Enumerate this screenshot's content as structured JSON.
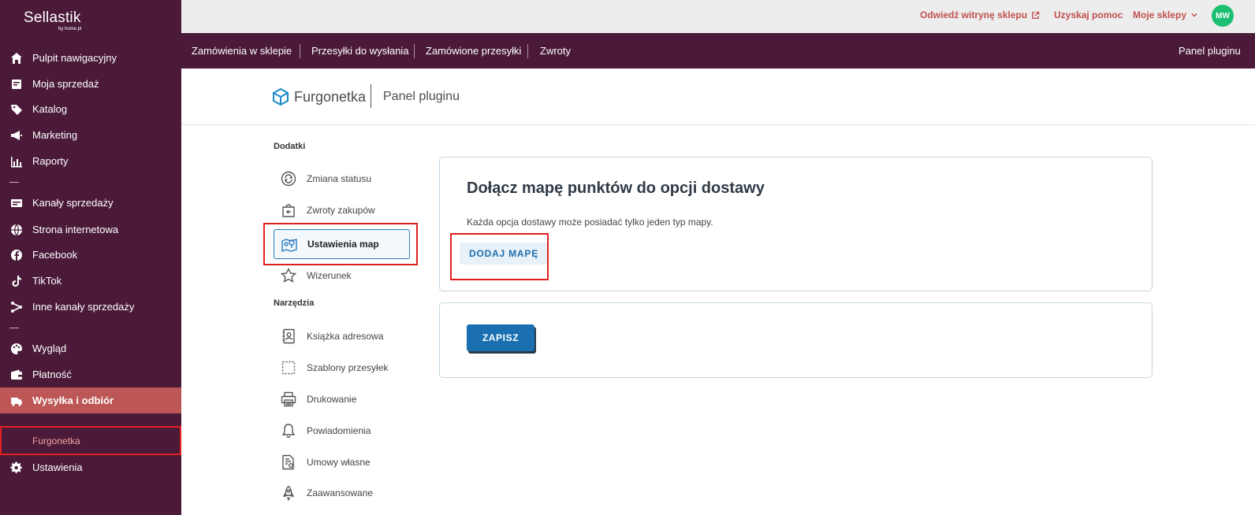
{
  "brand": {
    "name": "Sellastik",
    "sub": "by home.pl"
  },
  "sidebar": {
    "items": [
      {
        "label": "Pulpit nawigacyjny",
        "icon": "home-icon"
      },
      {
        "label": "Moja sprzedaż",
        "icon": "sales-icon"
      },
      {
        "label": "Katalog",
        "icon": "tag-icon"
      },
      {
        "label": "Marketing",
        "icon": "megaphone-icon"
      },
      {
        "label": "Raporty",
        "icon": "bar-chart-icon"
      },
      {
        "label": "Kanały sprzedaży",
        "icon": "channels-icon"
      },
      {
        "label": "Strona internetowa",
        "icon": "globe-icon"
      },
      {
        "label": "Facebook",
        "icon": "facebook-icon"
      },
      {
        "label": "TikTok",
        "icon": "tiktok-icon"
      },
      {
        "label": "Inne kanały sprzedaży",
        "icon": "share-icon"
      },
      {
        "label": "Wygląd",
        "icon": "palette-icon"
      },
      {
        "label": "Płatność",
        "icon": "wallet-icon"
      },
      {
        "label": "Wysyłka i odbiór",
        "icon": "truck-icon",
        "active": true
      },
      {
        "label": "Ustawienia",
        "icon": "gear-icon"
      }
    ],
    "subitem": "Furgonetka"
  },
  "topbar": {
    "visit_store": "Odwiedź witrynę sklepu",
    "help": "Uzyskaj pomoc",
    "my_stores": "Moje sklepy",
    "avatar": "MW"
  },
  "plugin_nav": {
    "tabs": [
      "Zamówienia w sklepie",
      "Przesyłki do wysłania",
      "Zamówione przesyłki",
      "Zwroty"
    ],
    "right": "Panel pluginu"
  },
  "header": {
    "logo_name": "Furgonetka",
    "title": "Panel pluginu"
  },
  "menu": {
    "section1_title": "Dodatki",
    "section1_items": [
      {
        "label": "Zmiana statusu",
        "icon": "refresh-icon"
      },
      {
        "label": "Zwroty zakupów",
        "icon": "return-bag-icon"
      },
      {
        "label": "Ustawienia map",
        "icon": "map-pin-icon",
        "active": true
      },
      {
        "label": "Wizerunek",
        "icon": "star-icon"
      }
    ],
    "section2_title": "Narzędzia",
    "section2_items": [
      {
        "label": "Książka adresowa",
        "icon": "address-book-icon"
      },
      {
        "label": "Szablony przesyłek",
        "icon": "template-icon"
      },
      {
        "label": "Drukowanie",
        "icon": "printer-icon"
      },
      {
        "label": "Powiadomienia",
        "icon": "bell-icon"
      },
      {
        "label": "Umowy własne",
        "icon": "contract-icon"
      },
      {
        "label": "Zaawansowane",
        "icon": "rocket-icon"
      }
    ]
  },
  "card": {
    "title": "Dołącz mapę punktów do opcji dostawy",
    "description": "Każda opcja dostawy może posiadać tylko jeden typ mapy.",
    "add_map_button": "DODAJ MAPĘ"
  },
  "save_card": {
    "save_button": "ZAPISZ"
  },
  "colors": {
    "sidebar_bg": "#4a1a38",
    "active_item": "#bd5656",
    "accent_blue": "#1a6fb0",
    "link_red": "#c0504d",
    "avatar_green": "#1dbf73"
  }
}
